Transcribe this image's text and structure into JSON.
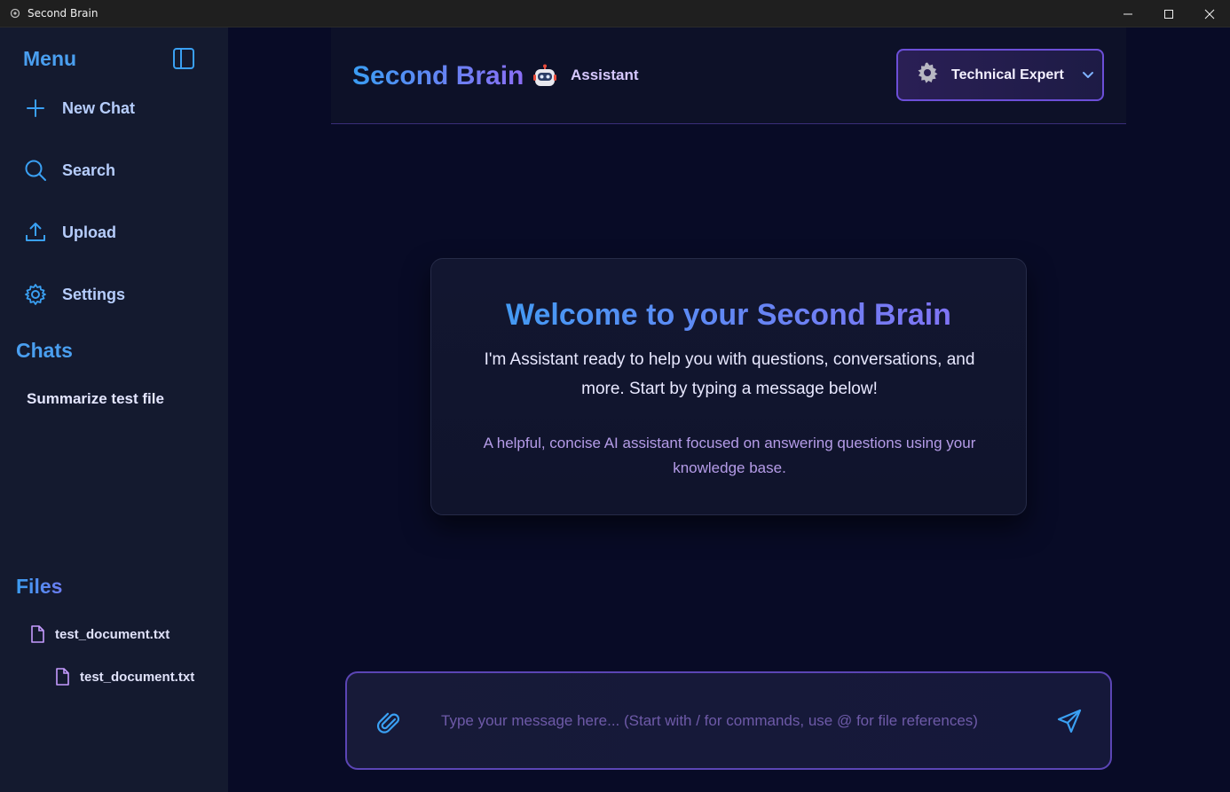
{
  "window": {
    "title": "Second Brain"
  },
  "sidebar": {
    "menu_title": "Menu",
    "nav": [
      {
        "label": "New Chat",
        "icon": "plus-icon"
      },
      {
        "label": "Search",
        "icon": "search-icon"
      },
      {
        "label": "Upload",
        "icon": "upload-icon"
      },
      {
        "label": "Settings",
        "icon": "gear-icon"
      }
    ],
    "chats_title": "Chats",
    "chats": [
      {
        "label": "Summarize test file"
      }
    ],
    "files_title": "Files",
    "files": [
      {
        "label": "test_document.txt"
      },
      {
        "label": "test_document.txt"
      }
    ]
  },
  "header": {
    "brand": "Second Brain",
    "assistant_name": "Assistant",
    "persona": "Technical Expert"
  },
  "welcome": {
    "title": "Welcome to your Second Brain",
    "text": "I'm Assistant ready to help you with questions, conversations, and more. Start by typing a message below!",
    "description": "A helpful, concise AI assistant focused on answering questions using your knowledge base."
  },
  "composer": {
    "placeholder": "Type your message here... (Start with / for commands, use @ for file references)"
  },
  "colors": {
    "accent_blue": "#3a9df3",
    "accent_purple": "#8b6ef5",
    "sidebar_bg": "#141a2f",
    "main_bg": "#080b26"
  }
}
